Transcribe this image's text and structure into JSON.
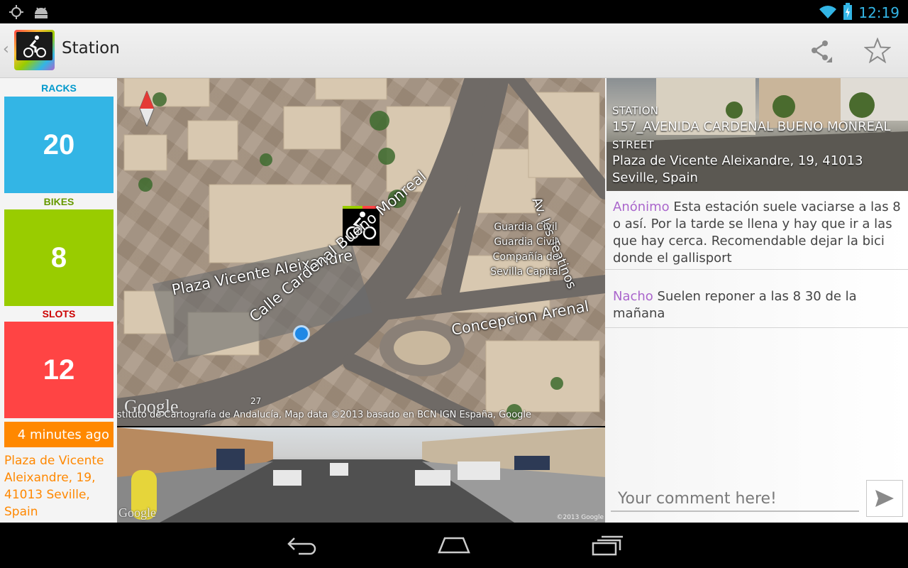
{
  "status_bar": {
    "time": "12:19",
    "left_icons": [
      "gps-icon",
      "android-debug-icon"
    ],
    "right_icons": [
      "wifi-icon",
      "battery-icon"
    ]
  },
  "action_bar": {
    "title": "Station",
    "actions": [
      "share-icon",
      "star-icon"
    ]
  },
  "counters": {
    "racks_label": "RACKS",
    "racks_value": "20",
    "bikes_label": "BIKES",
    "bikes_value": "8",
    "slots_label": "SLOTS",
    "slots_value": "12",
    "racks_color": "#33b5e5",
    "bikes_color": "#99cc00",
    "slots_color": "#ff4444"
  },
  "updated": "4 minutes ago",
  "left_address": "Plaza de Vicente Aleixandre, 19, 41013 Seville, Spain",
  "map": {
    "labels": {
      "plaza": "Plaza Vicente Aleixandre",
      "calle": "Calle Cardenal Bueno Monreal",
      "concepcion": "Concepcion Arenal",
      "teatinos": "Av. los Teatinos",
      "guardia_1": "Guardia Civil",
      "guardia_2": "Guardia Civil",
      "guardia_3": "Compañía de",
      "guardia_4": "Sevilla Capital",
      "number": "27"
    },
    "logo": "Google",
    "attribution": "stituto de Cartografía de Andalucía, Map data ©2013 basado en BCN IGN España, Google"
  },
  "streetview": {
    "logo": "Google",
    "copyright": "©2013 Google"
  },
  "station": {
    "station_label": "STATION",
    "station_name": "157_AVENIDA CARDENAL BUENO MONREAL",
    "street_label": "STREET",
    "street_value": "Plaza de Vicente Aleixandre, 19, 41013 Seville, Spain"
  },
  "comments": [
    {
      "author": "Anónimo",
      "text": " Esta estación suele vaciarse a las 8 o así. Por la tarde se llena y hay que ir a las que hay cerca. Recomendable dejar la bici donde el gallisport"
    },
    {
      "author": "Nacho",
      "text": " Suelen reponer a las 8 30 de la mañana"
    }
  ],
  "comment_input": {
    "placeholder": "Your comment here!"
  },
  "nav_bar": [
    "back-icon",
    "home-icon",
    "recent-apps-icon"
  ]
}
